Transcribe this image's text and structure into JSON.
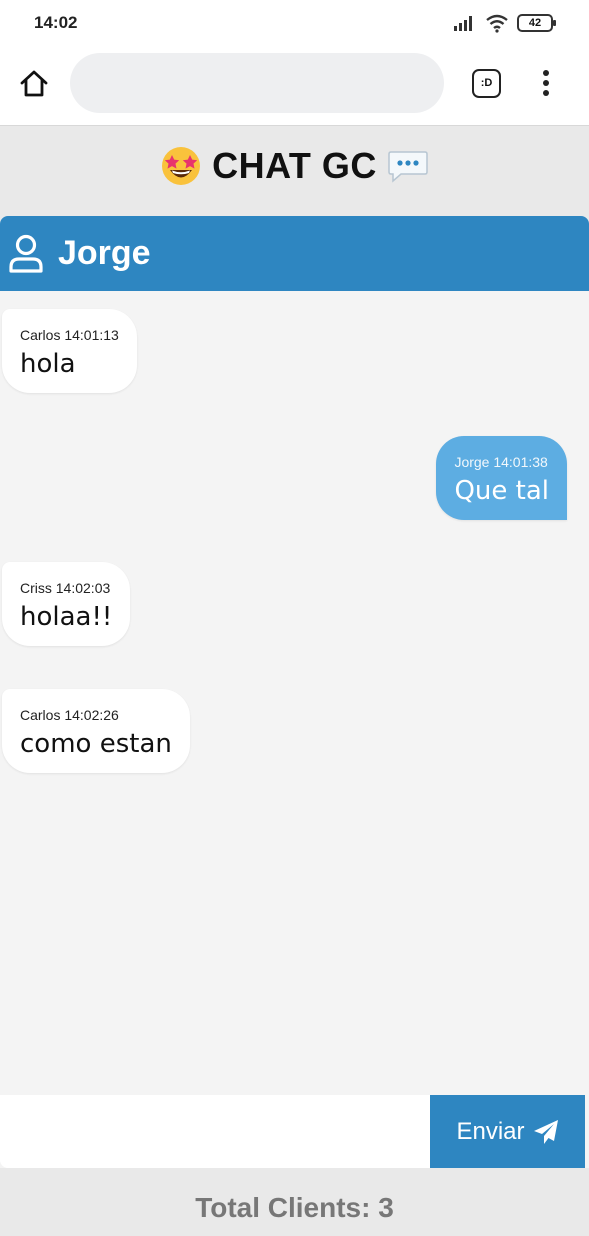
{
  "status_bar": {
    "time": "14:02",
    "battery": "42",
    "icons": [
      "signal-icon",
      "wifi-icon",
      "battery-icon"
    ]
  },
  "browser": {
    "url_placeholder": "",
    "tab_label": ":D",
    "icons": [
      "home-icon",
      "tabs-icon",
      "menu-icon"
    ]
  },
  "app": {
    "title": "CHAT GC",
    "title_icons": [
      "star-struck-emoji-icon",
      "speech-bubble-icon"
    ]
  },
  "chat": {
    "username": "Jorge",
    "header_icon": "user-icon",
    "messages": [
      {
        "side": "left",
        "meta": "Carlos 14:01:13",
        "text": "hola"
      },
      {
        "side": "right",
        "meta": "Jorge 14:01:38",
        "text": "Que tal"
      },
      {
        "side": "left",
        "meta": "Criss 14:02:03",
        "text": "holaa!!"
      },
      {
        "side": "left",
        "meta": "Carlos 14:02:26",
        "text": "como estan"
      }
    ]
  },
  "composer": {
    "input_value": "",
    "send_label": "Enviar",
    "send_icon": "paper-plane-icon"
  },
  "footer": {
    "total_clients": "Total Clients: 3"
  },
  "colors": {
    "primary": "#2e86c1",
    "own_bubble": "#5dade2",
    "chat_background": "#f4f4f4",
    "page_background": "#e9e9e9"
  }
}
